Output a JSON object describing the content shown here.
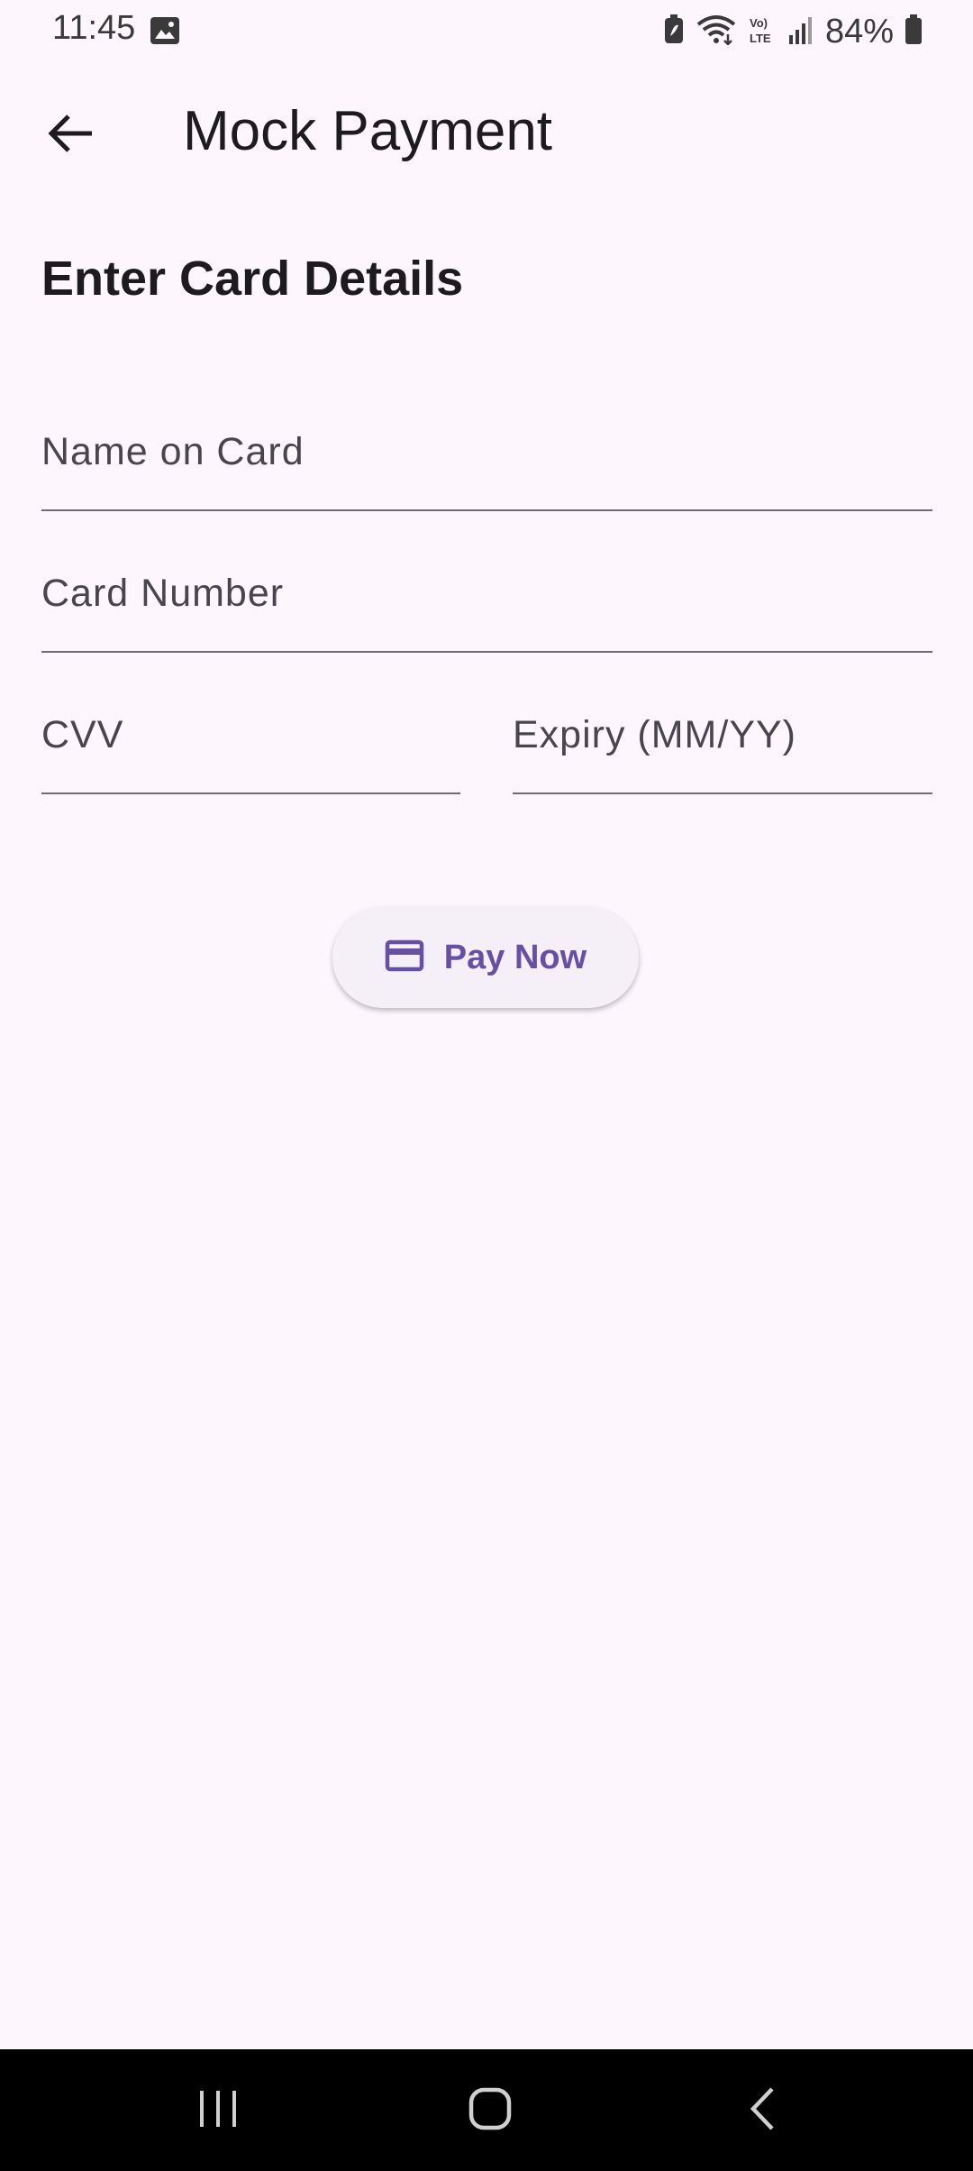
{
  "status_bar": {
    "time": "11:45",
    "battery_percent": "84%",
    "icons": [
      "image-icon",
      "battery-saver-icon",
      "wifi-icon",
      "volte-icon",
      "signal-icon",
      "battery-icon"
    ]
  },
  "app_bar": {
    "title": "Mock Payment",
    "back_icon": "arrow-back-icon"
  },
  "form": {
    "heading": "Enter Card Details",
    "name_label": "Name on Card",
    "card_number_label": "Card Number",
    "cvv_label": "CVV",
    "expiry_label": "Expiry (MM/YY)"
  },
  "pay_button": {
    "label": "Pay Now",
    "icon": "credit-card-icon"
  },
  "colors": {
    "background": "#fdf7fd",
    "accent": "#6750a4",
    "button_bg": "#f5eff7",
    "nav_bar": "#000000"
  },
  "nav_bar": {
    "icons": [
      "recent-apps-icon",
      "home-icon",
      "back-icon"
    ]
  }
}
